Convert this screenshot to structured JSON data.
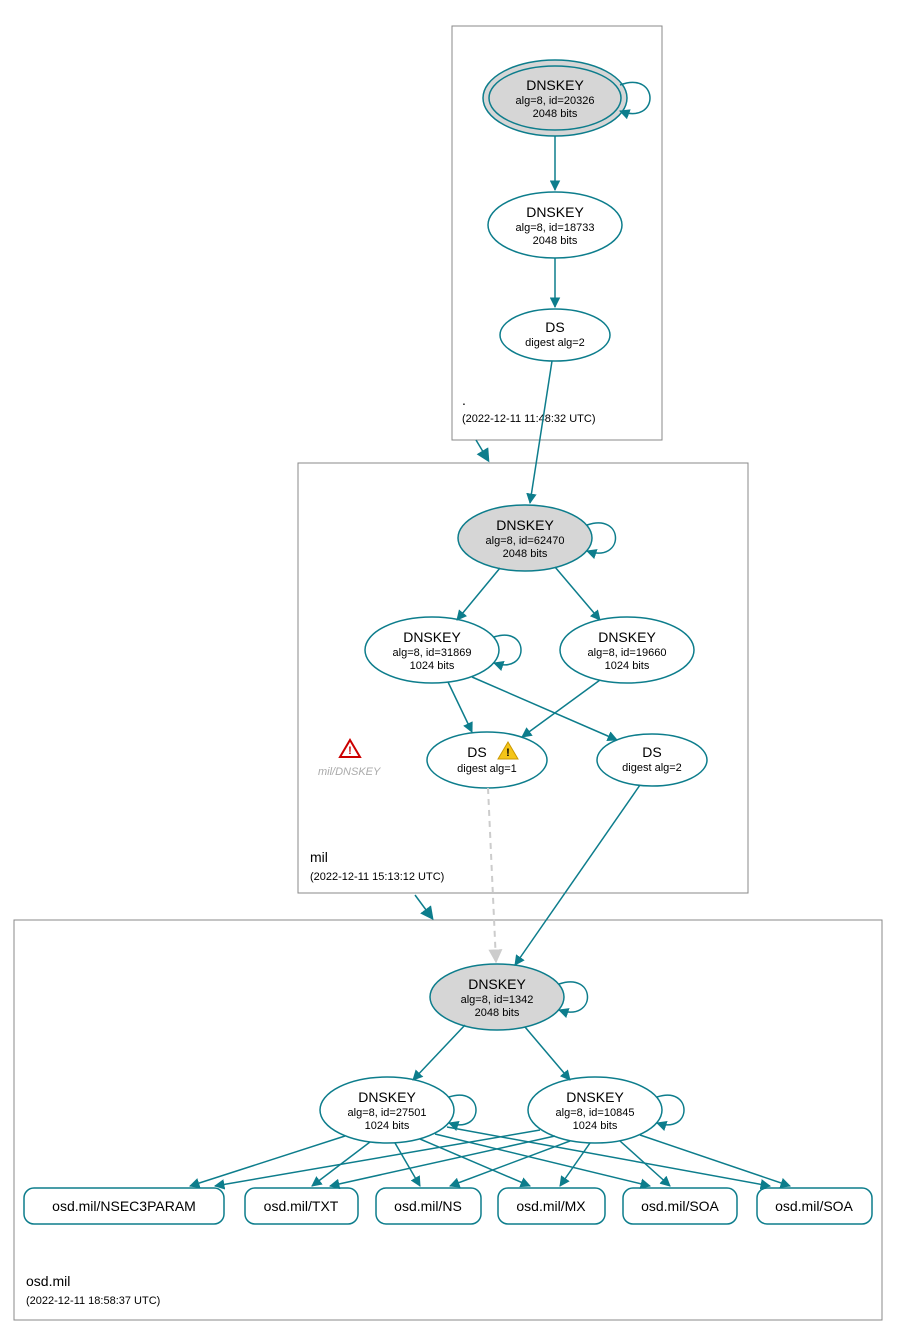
{
  "colors": {
    "teal": "#0d7d8c",
    "grey_fill": "#d6d6d6",
    "white": "#ffffff",
    "box_border": "#888888"
  },
  "zones": {
    "root": {
      "label": ".",
      "timestamp": "(2022-12-11 11:48:32 UTC)"
    },
    "mil": {
      "label": "mil",
      "timestamp": "(2022-12-11 15:13:12 UTC)"
    },
    "osd": {
      "label": "osd.mil",
      "timestamp": "(2022-12-11 18:58:37 UTC)"
    }
  },
  "nodes": {
    "root_ksk": {
      "title": "DNSKEY",
      "line2": "alg=8, id=20326",
      "line3": "2048 bits"
    },
    "root_zsk": {
      "title": "DNSKEY",
      "line2": "alg=8, id=18733",
      "line3": "2048 bits"
    },
    "root_ds": {
      "title": "DS",
      "line2": "digest alg=2"
    },
    "mil_ksk": {
      "title": "DNSKEY",
      "line2": "alg=8, id=62470",
      "line3": "2048 bits"
    },
    "mil_zsk1": {
      "title": "DNSKEY",
      "line2": "alg=8, id=31869",
      "line3": "1024 bits"
    },
    "mil_zsk2": {
      "title": "DNSKEY",
      "line2": "alg=8, id=19660",
      "line3": "1024 bits"
    },
    "mil_ds1": {
      "title": "DS",
      "line2": "digest alg=1"
    },
    "mil_ds2": {
      "title": "DS",
      "line2": "digest alg=2"
    },
    "osd_ksk": {
      "title": "DNSKEY",
      "line2": "alg=8, id=1342",
      "line3": "2048 bits"
    },
    "osd_zsk1": {
      "title": "DNSKEY",
      "line2": "alg=8, id=27501",
      "line3": "1024 bits"
    },
    "osd_zsk2": {
      "title": "DNSKEY",
      "line2": "alg=8, id=10845",
      "line3": "1024 bits"
    },
    "rr1": {
      "label": "osd.mil/NSEC3PARAM"
    },
    "rr2": {
      "label": "osd.mil/TXT"
    },
    "rr3": {
      "label": "osd.mil/NS"
    },
    "rr4": {
      "label": "osd.mil/MX"
    },
    "rr5": {
      "label": "osd.mil/SOA"
    },
    "rr6": {
      "label": "osd.mil/SOA"
    }
  },
  "warnings": {
    "mil_dnskey": "mil/DNSKEY"
  }
}
